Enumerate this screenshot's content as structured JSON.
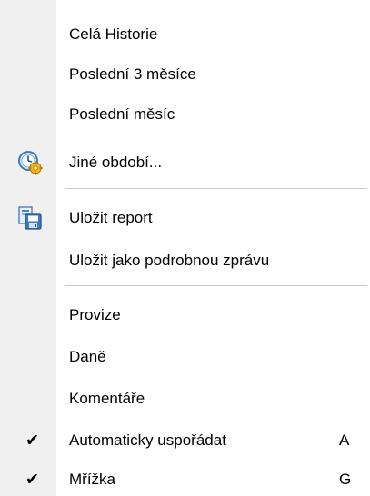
{
  "menu": {
    "items": [
      {
        "label": "Celá Historie"
      },
      {
        "label": "Poslední 3 měsíce"
      },
      {
        "label": "Poslední měsíc"
      },
      {
        "label": "Jiné období...",
        "icon": "clock-gear-icon"
      },
      {
        "label": "Uložit report",
        "icon": "save-report-icon"
      },
      {
        "label": "Uložit jako podrobnou zprávu"
      },
      {
        "label": "Provize"
      },
      {
        "label": "Daně"
      },
      {
        "label": "Komentáře"
      },
      {
        "label": "Automaticky uspořádat",
        "checked": true,
        "shortcut": "A"
      },
      {
        "label": "Mřížka",
        "checked": true,
        "shortcut": "G"
      }
    ],
    "check_glyph": "✔"
  }
}
